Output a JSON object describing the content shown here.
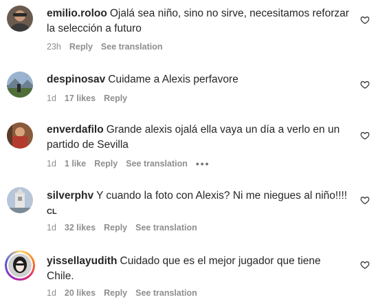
{
  "comments": [
    {
      "username": "emilio.roloo",
      "text": "Ojalá sea niño, sino no sirve, necesitamos reforzar la selección a futuro",
      "time": "23h",
      "likes": "",
      "reply": "Reply",
      "translate": "See translation",
      "more": "",
      "extra": ""
    },
    {
      "username": "despinosav",
      "text": "Cuidame a Alexis perfavore",
      "time": "1d",
      "likes": "17 likes",
      "reply": "Reply",
      "translate": "",
      "more": "",
      "extra": ""
    },
    {
      "username": "enverdafilo",
      "text": "Grande alexis ojalá ella vaya un día a verlo en un partido de Sevilla",
      "time": "1d",
      "likes": "1 like",
      "reply": "Reply",
      "translate": "See translation",
      "more": "•••",
      "extra": ""
    },
    {
      "username": "silverphv",
      "text": "Y cuando la foto con Alexis? Ni me niegues al niño!!!!",
      "time": "1d",
      "likes": "32 likes",
      "reply": "Reply",
      "translate": "See translation",
      "more": "",
      "extra": "CL"
    },
    {
      "username": "yissellayudith",
      "text": "Cuidado que es el mejor jugador que tiene Chile.",
      "time": "1d",
      "likes": "20 likes",
      "reply": "Reply",
      "translate": "See translation",
      "more": "",
      "extra": ""
    }
  ],
  "icons": {
    "like": "heart-outline-icon",
    "more": "more-options-icon"
  },
  "colors": {
    "text": "#262626",
    "meta": "#8e8e8e"
  }
}
